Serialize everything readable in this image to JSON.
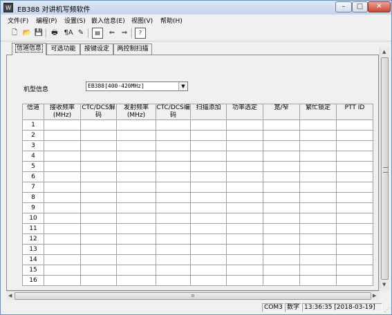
{
  "window": {
    "title": "EB388 对讲机写频软件",
    "icon": "app-icon",
    "app_icon_glyph": "W"
  },
  "window_buttons": {
    "minimize": "–",
    "maximize": "□",
    "close": "✕"
  },
  "menu": [
    "文件(F)",
    "编程(P)",
    "设置(S)",
    "嵌入信息(E)",
    "视图(V)",
    "帮助(H)"
  ],
  "toolbar": {
    "icons": [
      "new-file",
      "open-folder",
      "save-disk",
      "print",
      "read-radio",
      "write-radio",
      "program-panel",
      "transfer-left",
      "transfer-right",
      "help"
    ],
    "glyphs": [
      "🗋",
      "📂",
      "💾",
      "🖶",
      "¶A",
      "✎",
      "▤",
      "⇐",
      "⇒",
      "?"
    ]
  },
  "tabs": [
    "信道信息",
    "可选功能",
    "按键设定",
    "两控制扫描"
  ],
  "active_tab": 0,
  "model_label": "机型信息",
  "model_value": "EB388[400-420MHz]",
  "table": {
    "headers": [
      "信道",
      "接收频率(MHz)",
      "CTC/DCS解码",
      "发射频率(MHz)",
      "CTC/DCS编码",
      "扫描添加",
      "功率选定",
      "宽/窄",
      "繁忙锁定",
      "PTT ID"
    ],
    "rows": [
      "1",
      "2",
      "3",
      "4",
      "5",
      "6",
      "7",
      "8",
      "9",
      "10",
      "11",
      "12",
      "13",
      "14",
      "15",
      "16"
    ]
  },
  "status": {
    "port": "COM3",
    "mode": "数字",
    "datetime": "13:36:35 [2018-03-19]"
  },
  "scroll_glyphs": {
    "up": "▲",
    "down": "▼",
    "left": "◀",
    "right": "▶",
    "grip": "≡",
    "resize": "⋰"
  }
}
